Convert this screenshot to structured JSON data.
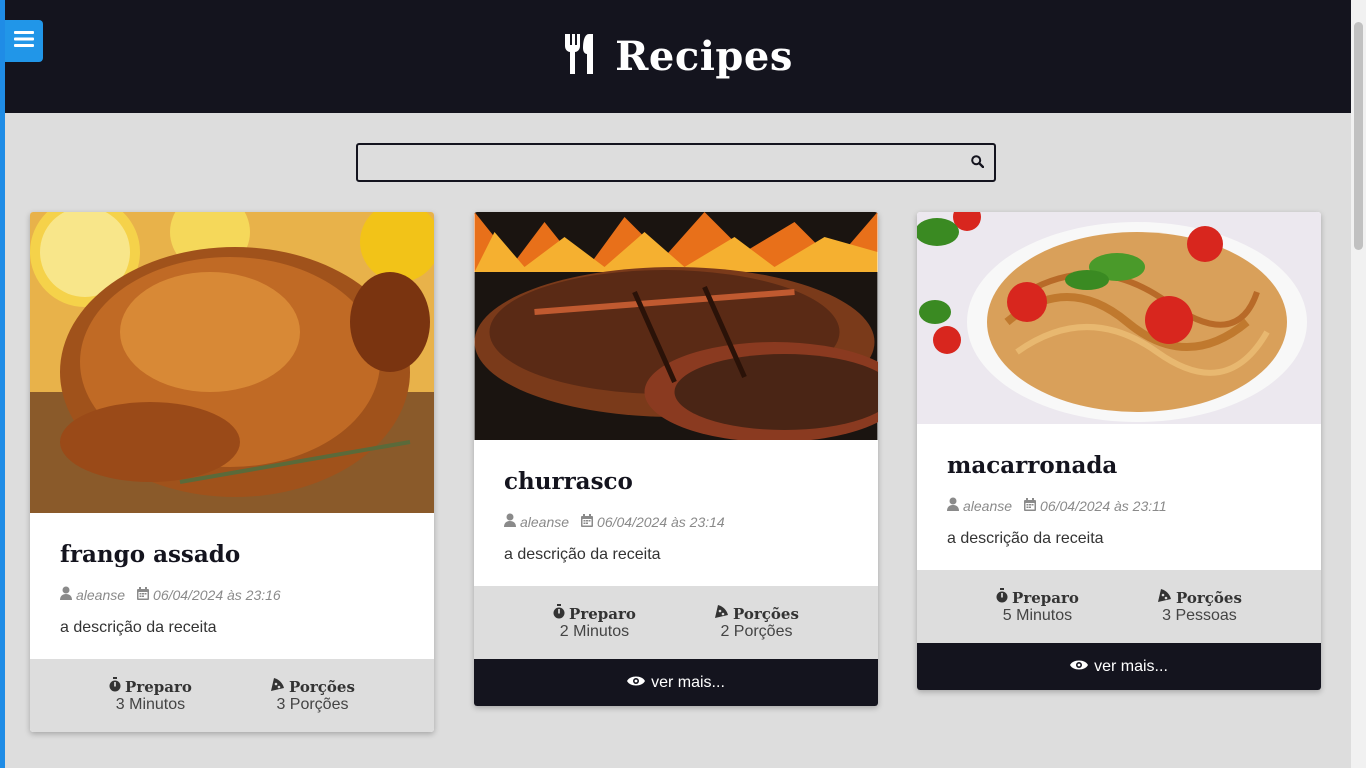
{
  "header": {
    "title": "Recipes",
    "logo_icon": "utensils-icon",
    "menu_icon": "hamburger-icon"
  },
  "search": {
    "placeholder": "",
    "value": ""
  },
  "recipes": [
    {
      "title": "frango assado",
      "author": "aleanse",
      "date": "06/04/2024 às 23:16",
      "description": "a descrição da receita",
      "prep_label": "Preparo",
      "prep_value": "3 Minutos",
      "portions_label": "Porções",
      "portions_value": "3 Porções"
    },
    {
      "title": "churrasco",
      "author": "aleanse",
      "date": "06/04/2024 às 23:14",
      "description": "a descrição da receita",
      "prep_label": "Preparo",
      "prep_value": "2 Minutos",
      "portions_label": "Porções",
      "portions_value": "2 Porções",
      "more_label": "ver mais..."
    },
    {
      "title": "macarronada",
      "author": "aleanse",
      "date": "06/04/2024 às 23:11",
      "description": "a descrição da receita",
      "prep_label": "Preparo",
      "prep_value": "5 Minutos",
      "portions_label": "Porções",
      "portions_value": "3 Pessoas",
      "more_label": "ver mais..."
    }
  ],
  "colors": {
    "dark": "#14141e",
    "accent": "#2196e8",
    "background": "#dddddd"
  }
}
